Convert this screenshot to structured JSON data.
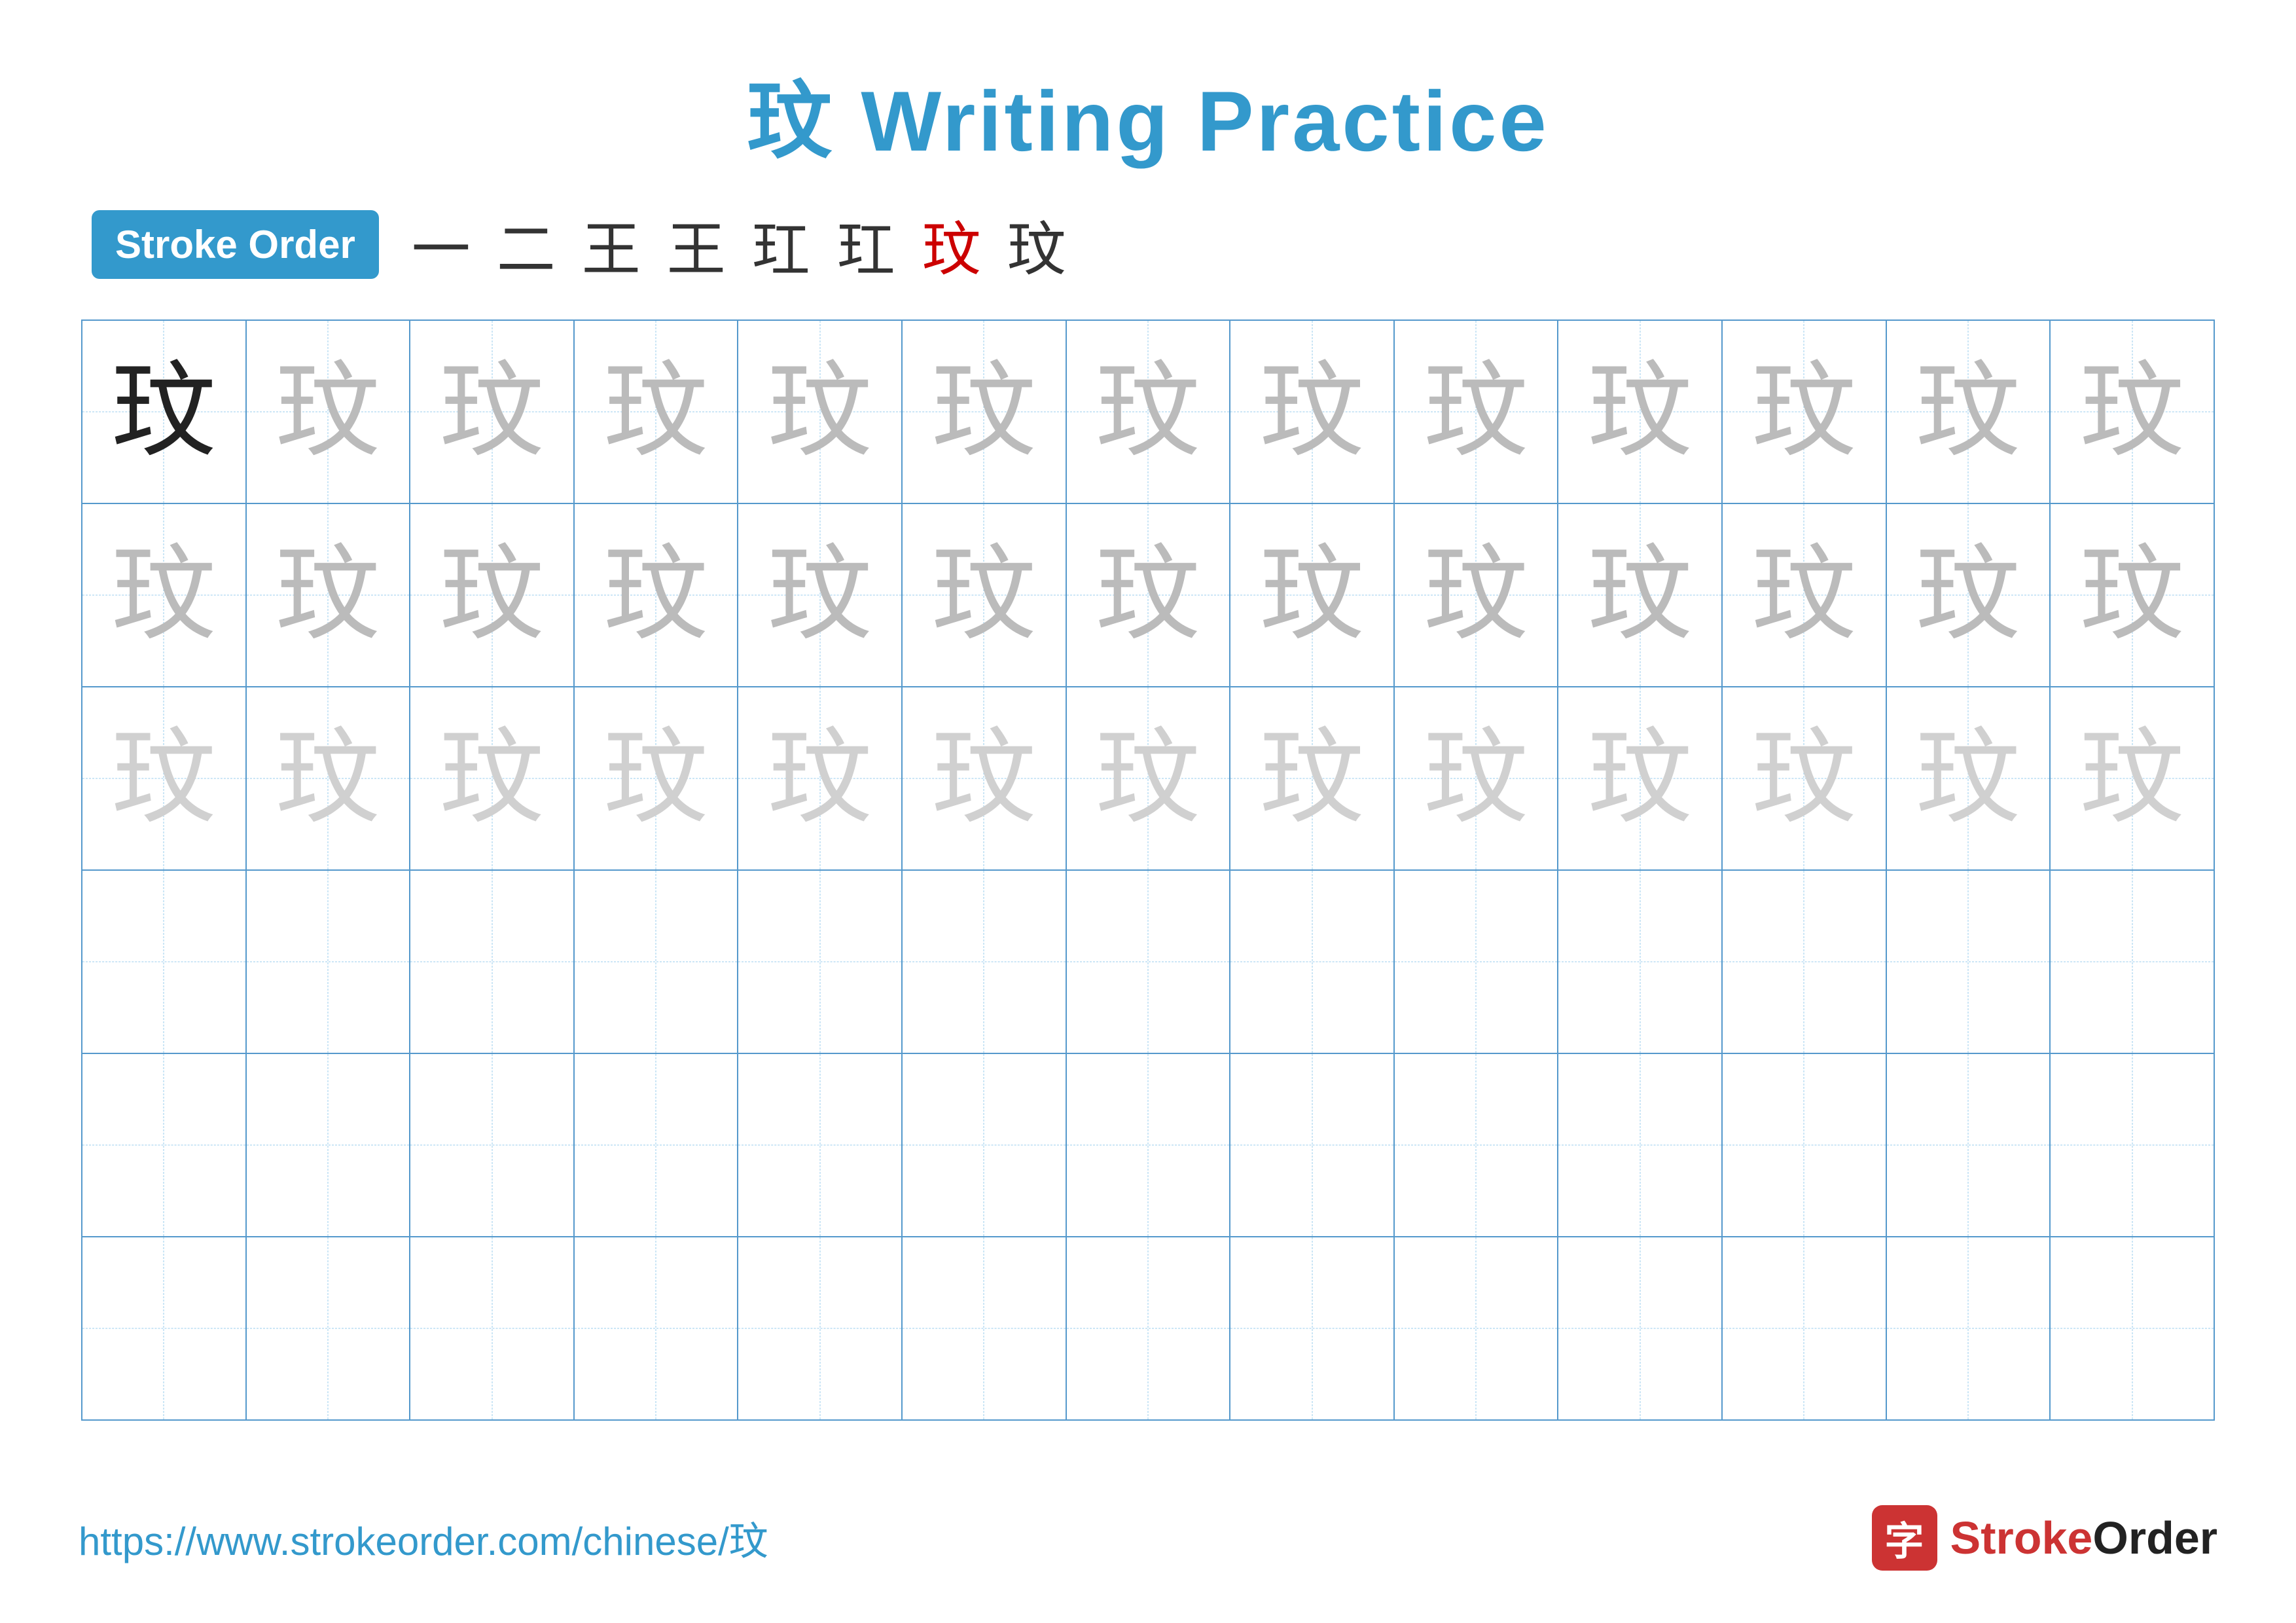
{
  "title": "玟 Writing Practice",
  "stroke_order_badge": "Stroke Order",
  "stroke_sequence": [
    "一",
    "二",
    "王",
    "王",
    "玒",
    "玒",
    "玟",
    "玟"
  ],
  "stroke_sequence_colors": [
    "dark",
    "dark",
    "dark",
    "dark",
    "dark",
    "dark",
    "red",
    "dark"
  ],
  "character": "玟",
  "grid": {
    "rows": 6,
    "cols": 13,
    "row_types": [
      "dark-first-light-rest",
      "medium-gray-all",
      "light-gray-all",
      "empty",
      "empty",
      "empty"
    ]
  },
  "footer": {
    "url": "https://www.strokeorder.com/chinese/玟",
    "logo_text": "StrokeOrder"
  }
}
